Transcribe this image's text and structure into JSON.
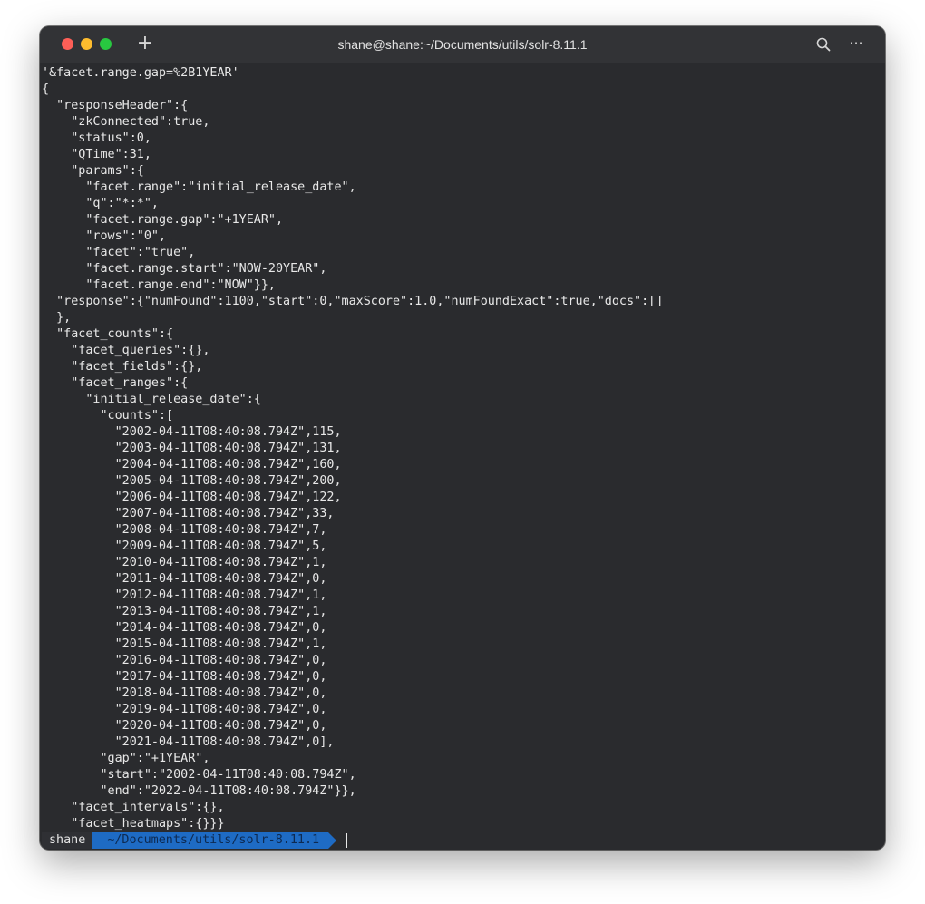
{
  "window": {
    "title": "shane@shane:~/Documents/utils/solr-8.11.1"
  },
  "toolbar": {
    "new_tab_icon": "plus-icon",
    "search_icon": "search-icon",
    "more_icon": "ellipsis-icon",
    "new_tab_glyph": "+",
    "more_glyph": "···"
  },
  "terminal": {
    "lines": [
      "'&facet.range.gap=%2B1YEAR'",
      "{",
      "  \"responseHeader\":{",
      "    \"zkConnected\":true,",
      "    \"status\":0,",
      "    \"QTime\":31,",
      "    \"params\":{",
      "      \"facet.range\":\"initial_release_date\",",
      "      \"q\":\"*:*\",",
      "      \"facet.range.gap\":\"+1YEAR\",",
      "      \"rows\":\"0\",",
      "      \"facet\":\"true\",",
      "      \"facet.range.start\":\"NOW-20YEAR\",",
      "      \"facet.range.end\":\"NOW\"}},",
      "  \"response\":{\"numFound\":1100,\"start\":0,\"maxScore\":1.0,\"numFoundExact\":true,\"docs\":[]",
      "  },",
      "  \"facet_counts\":{",
      "    \"facet_queries\":{},",
      "    \"facet_fields\":{},",
      "    \"facet_ranges\":{",
      "      \"initial_release_date\":{",
      "        \"counts\":[",
      "          \"2002-04-11T08:40:08.794Z\",115,",
      "          \"2003-04-11T08:40:08.794Z\",131,",
      "          \"2004-04-11T08:40:08.794Z\",160,",
      "          \"2005-04-11T08:40:08.794Z\",200,",
      "          \"2006-04-11T08:40:08.794Z\",122,",
      "          \"2007-04-11T08:40:08.794Z\",33,",
      "          \"2008-04-11T08:40:08.794Z\",7,",
      "          \"2009-04-11T08:40:08.794Z\",5,",
      "          \"2010-04-11T08:40:08.794Z\",1,",
      "          \"2011-04-11T08:40:08.794Z\",0,",
      "          \"2012-04-11T08:40:08.794Z\",1,",
      "          \"2013-04-11T08:40:08.794Z\",1,",
      "          \"2014-04-11T08:40:08.794Z\",0,",
      "          \"2015-04-11T08:40:08.794Z\",1,",
      "          \"2016-04-11T08:40:08.794Z\",0,",
      "          \"2017-04-11T08:40:08.794Z\",0,",
      "          \"2018-04-11T08:40:08.794Z\",0,",
      "          \"2019-04-11T08:40:08.794Z\",0,",
      "          \"2020-04-11T08:40:08.794Z\",0,",
      "          \"2021-04-11T08:40:08.794Z\",0],",
      "        \"gap\":\"+1YEAR\",",
      "        \"start\":\"2002-04-11T08:40:08.794Z\",",
      "        \"end\":\"2022-04-11T08:40:08.794Z\"}},",
      "    \"facet_intervals\":{},",
      "    \"facet_heatmaps\":{}}}"
    ],
    "prompt": {
      "user": "shane",
      "path": "~/Documents/utils/solr-8.11.1"
    }
  },
  "colors": {
    "terminal_bg": "#2a2b2e",
    "terminal_fg": "#e8e8e8",
    "prompt_path_bg": "#1e6bc4",
    "traffic_red": "#fe5f57",
    "traffic_yellow": "#febc2e",
    "traffic_green": "#28c840"
  }
}
